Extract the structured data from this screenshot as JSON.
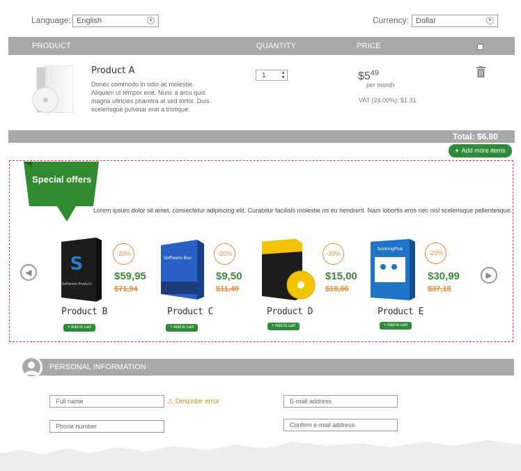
{
  "top": {
    "language_label": "Language:",
    "language_value": "English",
    "currency_label": "Currency:",
    "currency_value": "Dollar"
  },
  "cart": {
    "headers": {
      "product": "PRODUCT",
      "quantity": "QUANTITY",
      "price": "PRICE"
    },
    "item": {
      "name": "Product A",
      "description": "Donec commodo in odio ac molestie. Aliquam ut tempor erat. Nunc a arcu quis magna ultricies pharetra at sed tortor. Duis scelerisque pulvinar erat a tristique.",
      "quantity": "1",
      "price_main": "$5",
      "price_cents": "49",
      "price_period": "per month",
      "vat": "VAT (24.00%): $1.31"
    },
    "total": "Total: $6.80",
    "add_more": "Add more items"
  },
  "offers": {
    "title": "Special offers",
    "description": "Lorem ipsum dolor sit amet, consectetur adipiscing elit. Curabitur facilisis molestie mi eu hendrerit. Nam lobortis eros nec nisl scelerisque pellentesque.",
    "add_to_cart": "Add to cart",
    "products": [
      {
        "name": "Product B",
        "discount": "-20%",
        "price": "$59,95",
        "old_price": "$71,94",
        "box_label": "Software Product"
      },
      {
        "name": "Product C",
        "discount": "-20%",
        "price": "$9,50",
        "old_price": "$11,40",
        "box_label": "Software Box"
      },
      {
        "name": "Product D",
        "discount": "-20%",
        "price": "$15,00",
        "old_price": "$18,00",
        "box_label": ""
      },
      {
        "name": "Product E",
        "discount": "-20%",
        "price": "$30,99",
        "old_price": "$37,18",
        "box_label": "bookingPlus"
      }
    ]
  },
  "personal": {
    "title": "PERSONAL INFORMATION",
    "full_name": "Full name",
    "phone": "Phone number",
    "email": "E-mail address",
    "confirm_email": "Confirm e-mail address",
    "error": "Describe error"
  },
  "colors": {
    "green": "#2e8b3a",
    "orange": "#e68a3a",
    "gray_bar": "#a9a9a9",
    "red_dash": "#e03030"
  }
}
